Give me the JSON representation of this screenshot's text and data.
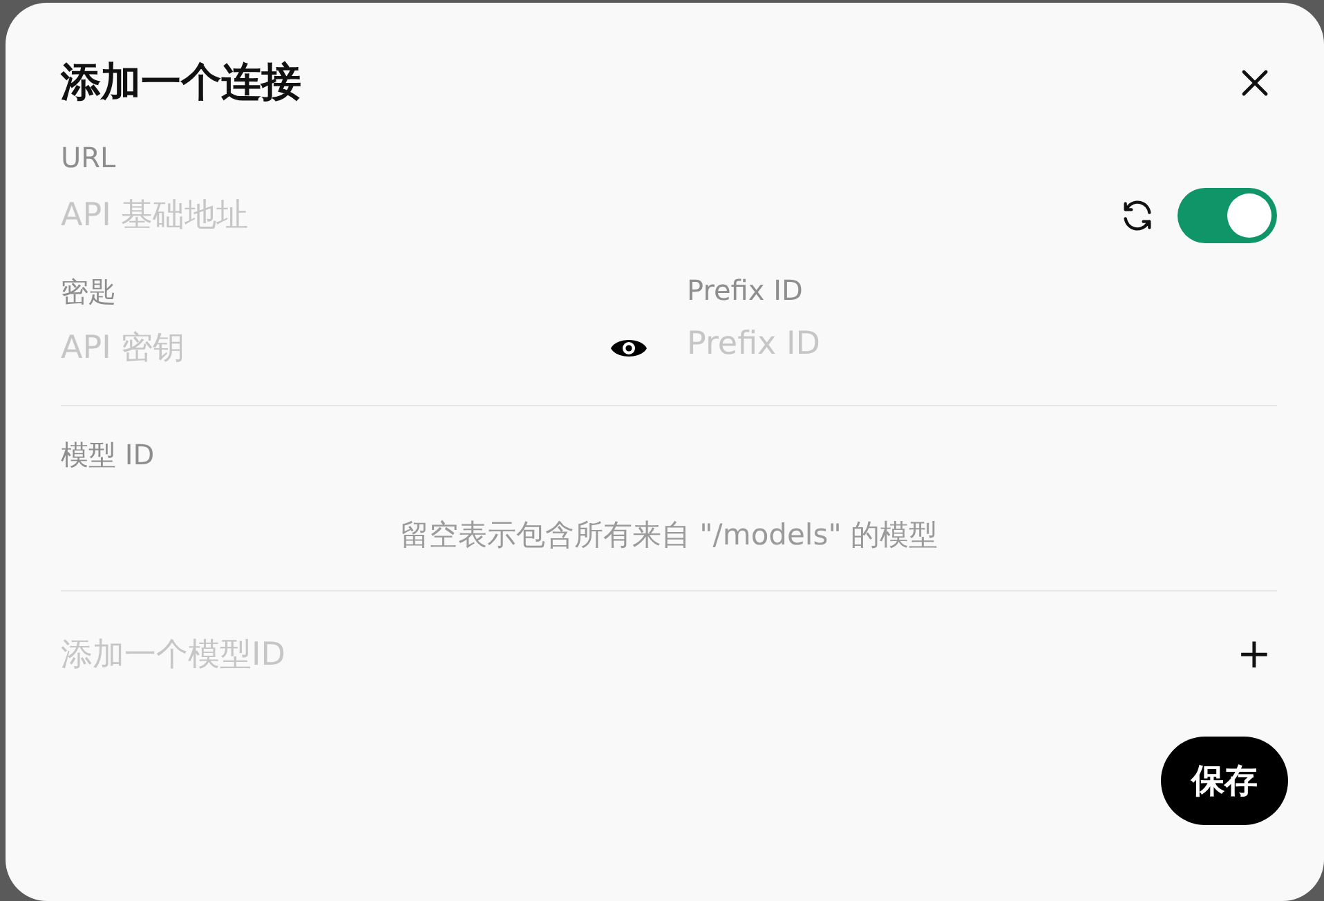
{
  "dialog": {
    "title": "添加一个连接"
  },
  "url": {
    "label": "URL",
    "placeholder": "API 基础地址",
    "enabled": true
  },
  "key": {
    "label": "密匙",
    "placeholder": "API 密钥"
  },
  "prefix": {
    "label": "Prefix ID",
    "placeholder": "Prefix ID"
  },
  "models": {
    "label": "模型 ID",
    "hint": "留空表示包含所有来自 \"/models\" 的模型",
    "add_placeholder": "添加一个模型ID",
    "add_icon": "+"
  },
  "buttons": {
    "save": "保存"
  }
}
